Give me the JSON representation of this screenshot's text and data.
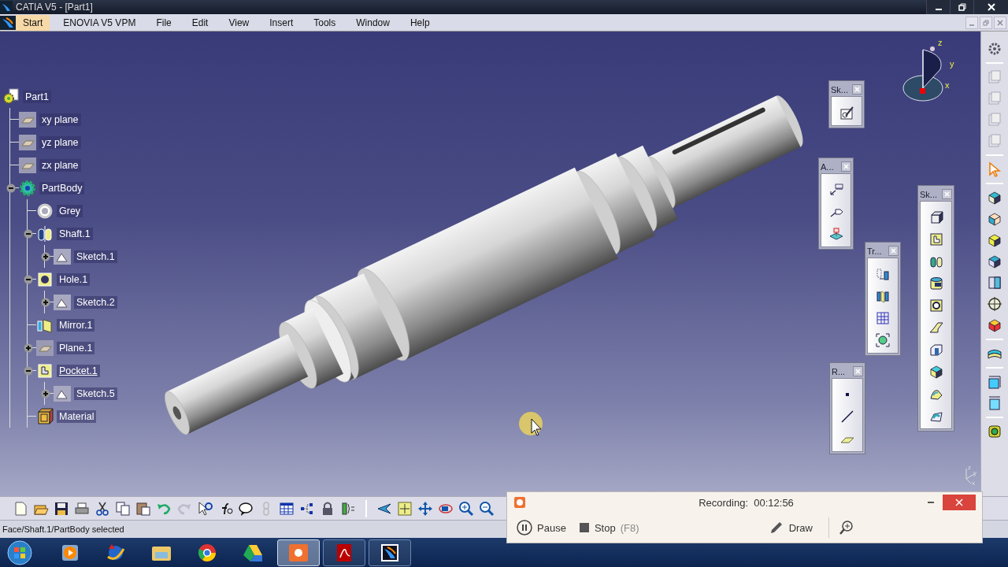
{
  "window": {
    "title": "CATIA V5 - [Part1]"
  },
  "menu": [
    {
      "label": "Start",
      "selected": true
    },
    {
      "label": "ENOVIA V5 VPM",
      "selected": false
    },
    {
      "label": "File",
      "selected": false
    },
    {
      "label": "Edit",
      "selected": false
    },
    {
      "label": "View",
      "selected": false
    },
    {
      "label": "Insert",
      "selected": false
    },
    {
      "label": "Tools",
      "selected": false
    },
    {
      "label": "Window",
      "selected": false
    },
    {
      "label": "Help",
      "selected": false
    }
  ],
  "tree": {
    "label": "Part1",
    "kind": "part",
    "selected": false,
    "children": [
      {
        "label": "xy plane",
        "kind": "plane",
        "selected": false
      },
      {
        "label": "yz plane",
        "kind": "plane",
        "selected": false
      },
      {
        "label": "zx plane",
        "kind": "plane",
        "selected": false
      },
      {
        "label": "PartBody",
        "kind": "body",
        "selected": false,
        "expanded": true,
        "children": [
          {
            "label": "Grey",
            "kind": "color",
            "selected": false
          },
          {
            "label": "Shaft.1",
            "kind": "shaft",
            "selected": false,
            "expanded": true,
            "children": [
              {
                "label": "Sketch.1",
                "kind": "sketch",
                "selected": false,
                "expanded": false
              }
            ]
          },
          {
            "label": "Hole.1",
            "kind": "hole",
            "selected": false,
            "expanded": true,
            "children": [
              {
                "label": "Sketch.2",
                "kind": "sketch",
                "selected": false,
                "expanded": false
              }
            ]
          },
          {
            "label": "Mirror.1",
            "kind": "mirror",
            "selected": false
          },
          {
            "label": "Plane.1",
            "kind": "plane",
            "selected": false,
            "expanded": false
          },
          {
            "label": "Pocket.1",
            "kind": "pocket",
            "selected": true,
            "expanded": true,
            "children": [
              {
                "label": "Sketch.5",
                "kind": "sketch",
                "selected": false,
                "expanded": false
              }
            ]
          },
          {
            "label": "Material",
            "kind": "material",
            "selected": false
          }
        ]
      }
    ]
  },
  "compass": {
    "labels": [
      "z",
      "y",
      "x"
    ]
  },
  "floating_toolbars": [
    {
      "title": "Sk...",
      "kind": "sketcher"
    },
    {
      "title": "A...",
      "kind": "annotations"
    },
    {
      "title": "Tr...",
      "kind": "transformation"
    },
    {
      "title": "R...",
      "kind": "reference"
    },
    {
      "title": "Sk...",
      "kind": "sketch-based"
    }
  ],
  "mini_axis": {
    "labels": [
      "z",
      "y",
      "x"
    ]
  },
  "status_bar": {
    "text": "Face/Shaft.1/PartBody selected"
  },
  "recorder": {
    "status": "Recording:",
    "time": "00:12:56",
    "pause": "Pause",
    "stop": "Stop",
    "stop_shortcut": "(F8)",
    "draw": "Draw"
  },
  "taskbar": [
    {
      "kind": "media",
      "running": false,
      "selected": false
    },
    {
      "kind": "arrow-globe",
      "running": false,
      "selected": false
    },
    {
      "kind": "folder",
      "running": false,
      "selected": false
    },
    {
      "kind": "browser",
      "running": false,
      "selected": false
    },
    {
      "kind": "drive",
      "running": false,
      "selected": false
    },
    {
      "kind": "recorder",
      "running": true,
      "selected": true
    },
    {
      "kind": "pdf",
      "running": true,
      "selected": false
    },
    {
      "kind": "cad",
      "running": true,
      "selected": false
    }
  ]
}
